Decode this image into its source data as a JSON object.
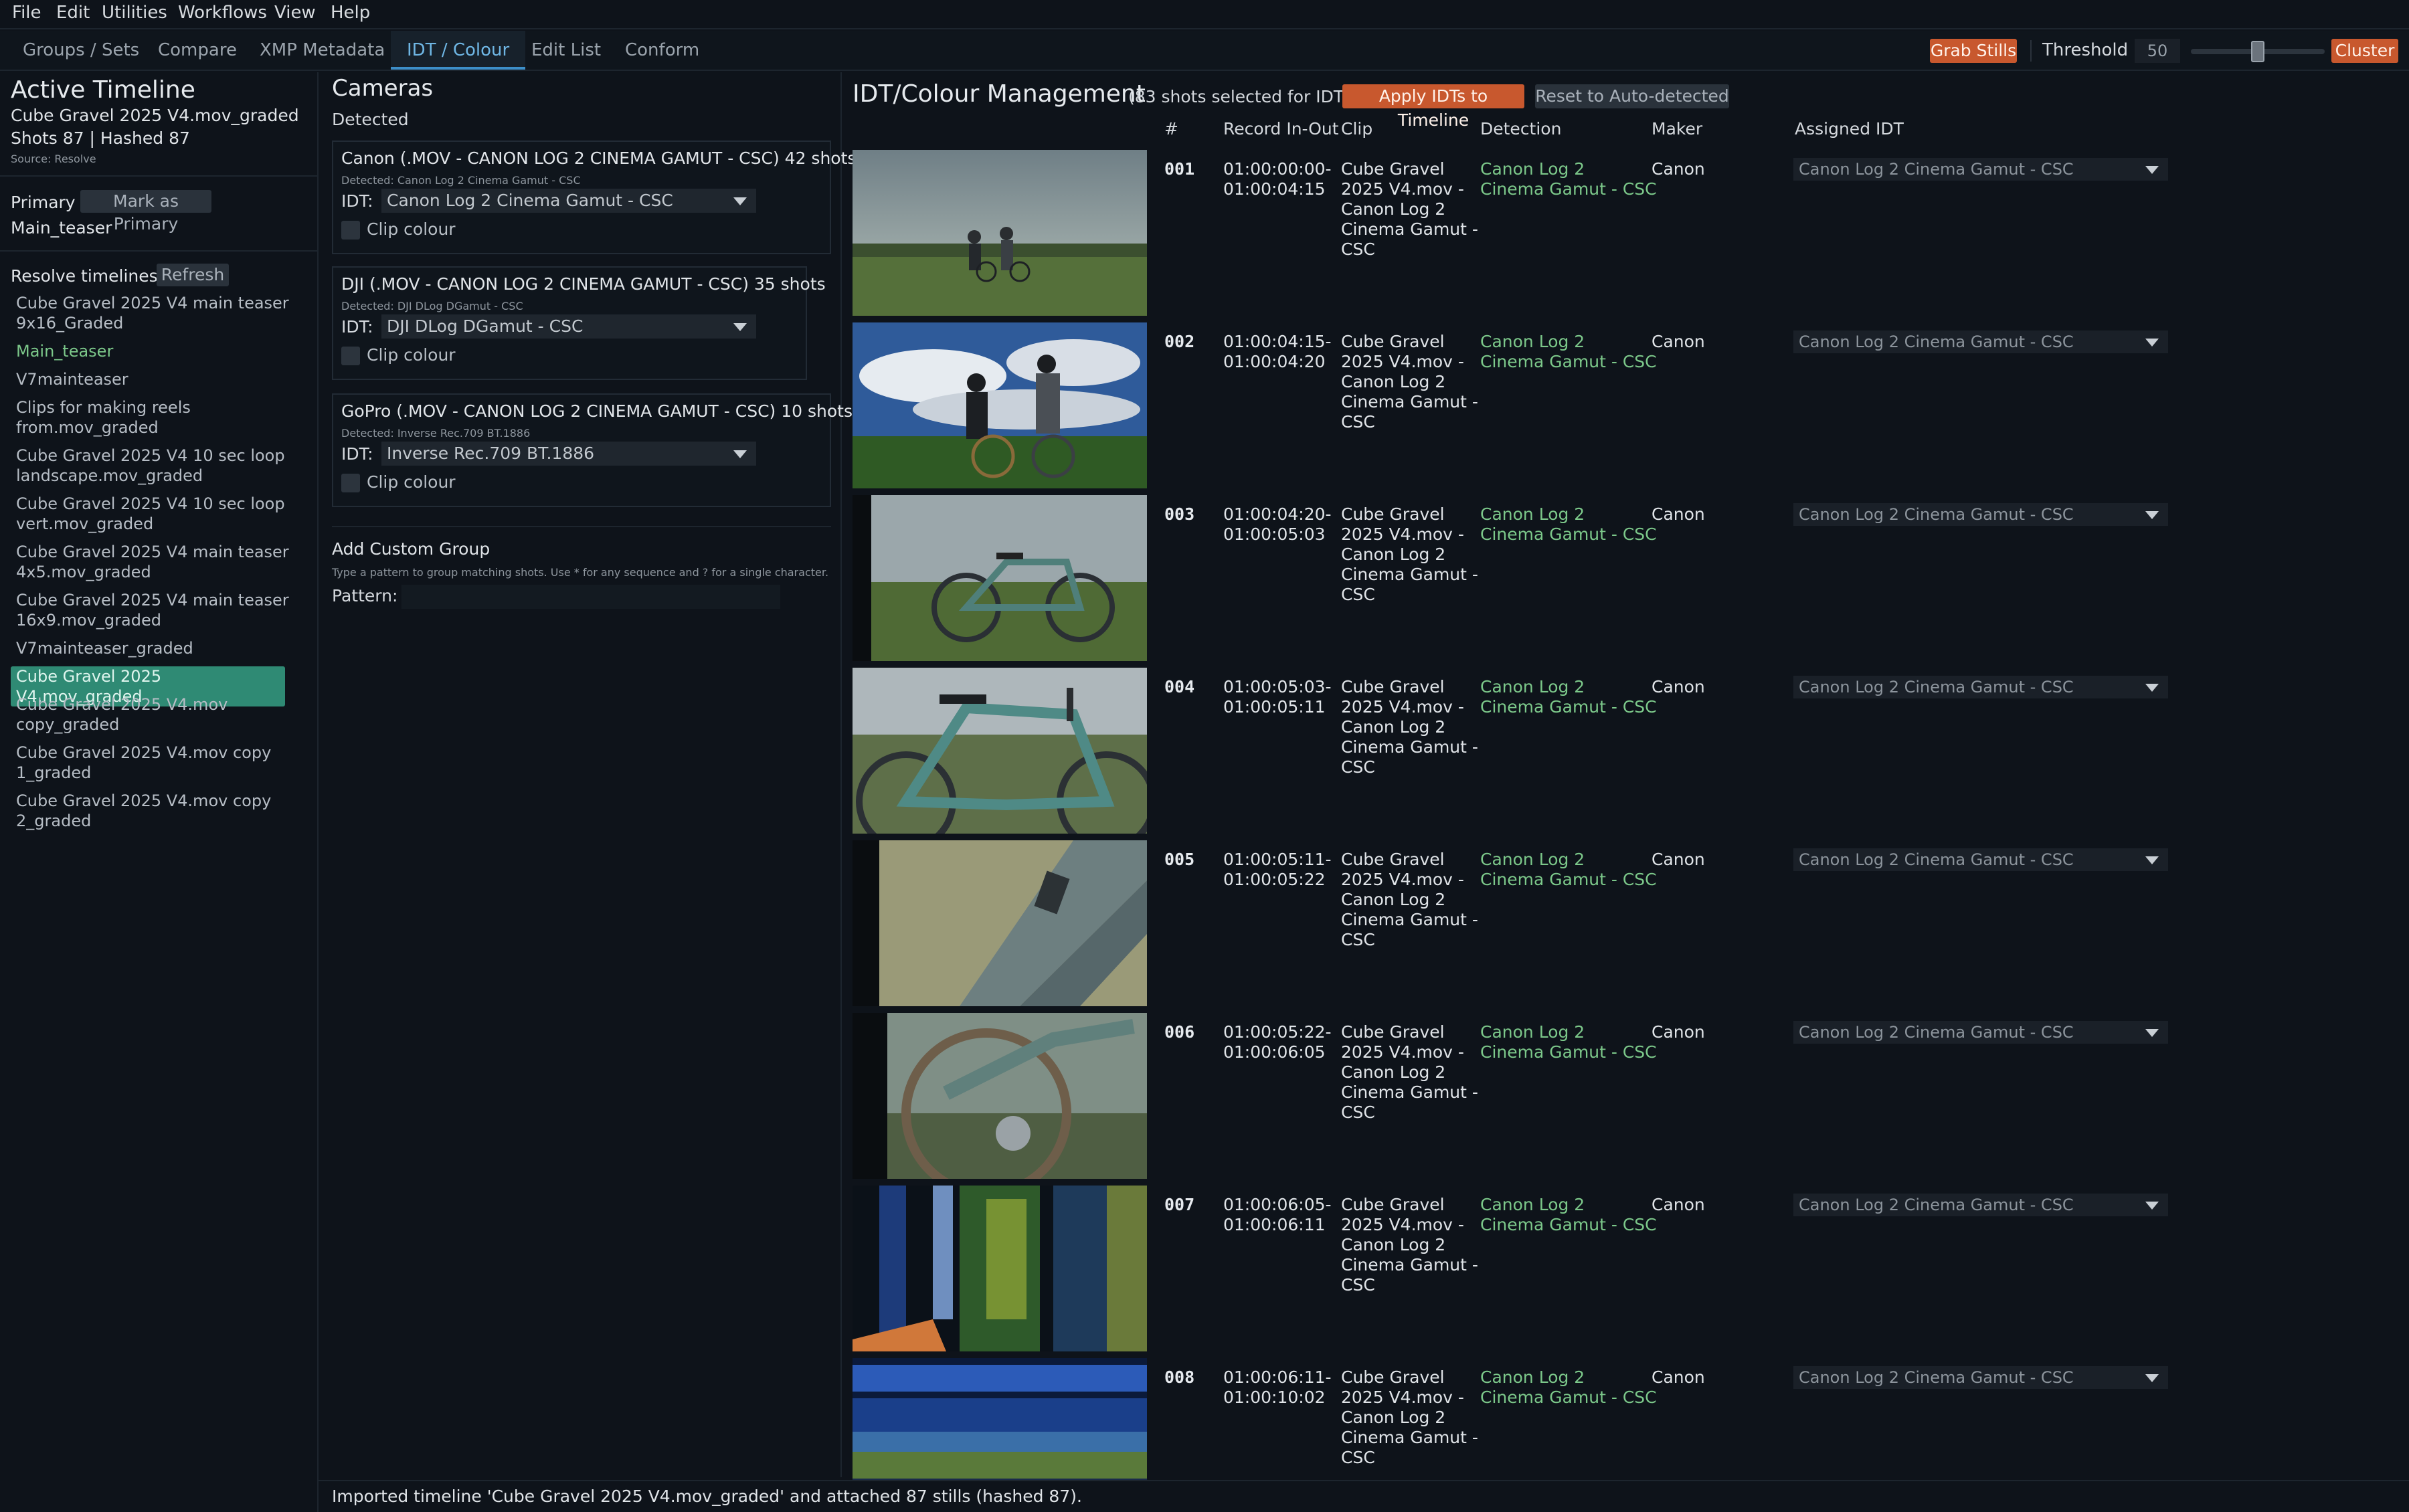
{
  "menu": [
    "File",
    "Edit",
    "Utilities",
    "Workflows",
    "View",
    "Help"
  ],
  "tabs": [
    {
      "label": "Groups / Sets"
    },
    {
      "label": "Compare"
    },
    {
      "label": "XMP Metadata"
    },
    {
      "label": "IDT / Colour",
      "active": true
    },
    {
      "label": "Edit List"
    },
    {
      "label": "Conform"
    }
  ],
  "toolbar": {
    "grab_stills": "Grab Stills",
    "threshold_label": "Threshold",
    "threshold_value": "50",
    "threshold_fraction": 0.5,
    "cluster": "Cluster"
  },
  "left": {
    "active_title": "Active Timeline",
    "timeline_name": "Cube Gravel 2025 V4.mov_graded",
    "shots_info": "Shots 87 | Hashed 87",
    "source": "Source: Resolve",
    "primary_label": "Primary",
    "mark_primary": "Mark as Primary",
    "primary_value": "Main_teaser",
    "resolve_label": "Resolve timelines",
    "refresh": "Refresh",
    "timelines": [
      {
        "text": "Cube Gravel 2025 V4 main teaser\n9x16_Graded"
      },
      {
        "text": "Main_teaser",
        "green": true
      },
      {
        "text": "V7mainteaser"
      },
      {
        "text": "Clips for making reels\nfrom.mov_graded"
      },
      {
        "text": "Cube Gravel 2025 V4 10 sec loop\nlandscape.mov_graded"
      },
      {
        "text": "Cube Gravel 2025 V4 10 sec loop\nvert.mov_graded"
      },
      {
        "text": "Cube Gravel 2025 V4 main teaser\n4x5.mov_graded"
      },
      {
        "text": "Cube Gravel 2025 V4 main teaser\n16x9.mov_graded"
      },
      {
        "text": "V7mainteaser_graded"
      },
      {
        "text": "Cube Gravel 2025 V4.mov_graded",
        "selected": true
      },
      {
        "text": "Cube Gravel 2025 V4.mov\ncopy_graded"
      },
      {
        "text": "Cube Gravel 2025 V4.mov copy\n1_graded"
      },
      {
        "text": "Cube Gravel 2025 V4.mov copy\n2_graded"
      }
    ]
  },
  "cameras": {
    "title": "Cameras",
    "detected_label": "Detected",
    "idt_label": "IDT:",
    "clip_colour": "Clip colour",
    "groups": [
      {
        "title": "Canon (.MOV - CANON LOG 2 CINEMA GAMUT - CSC)   42 shots",
        "detected": "Detected: Canon Log 2 Cinema Gamut - CSC",
        "idt": "Canon Log 2 Cinema Gamut - CSC"
      },
      {
        "title": "DJI (.MOV - CANON LOG 2 CINEMA GAMUT - CSC)   35 shots",
        "detected": "Detected: DJI DLog DGamut - CSC",
        "idt": "DJI DLog DGamut - CSC"
      },
      {
        "title": "GoPro (.MOV - CANON LOG 2 CINEMA GAMUT - CSC)   10 shots",
        "detected": "Detected: Inverse Rec.709 BT.1886",
        "idt": "Inverse Rec.709 BT.1886"
      }
    ],
    "custom_title": "Add Custom Group",
    "custom_hint": "Type a pattern to group matching shots. Use * for any sequence and ? for a single character.",
    "pattern_label": "Pattern:",
    "pattern_value": ""
  },
  "idt": {
    "title": "IDT/Colour Management",
    "selected_info": "(83 shots selected for IDT)",
    "apply": "Apply IDTs to Timeline",
    "reset": "Reset to Auto-detected",
    "headers": {
      "num": "#",
      "record": "Record In-Out",
      "clip": "Clip",
      "detection": "Detection",
      "maker": "Maker",
      "assigned": "Assigned IDT"
    },
    "rows": [
      {
        "num": "001",
        "rec_in": "01:00:00:00-",
        "rec_out": "01:00:04:15",
        "clip": "Cube Gravel\n2025 V4.mov -\nCanon Log 2\nCinema Gamut -\nCSC",
        "detection": "Canon Log 2\nCinema Gamut - CSC",
        "maker": "Canon",
        "assigned": "Canon Log 2 Cinema Gamut - CSC"
      },
      {
        "num": "002",
        "rec_in": "01:00:04:15-",
        "rec_out": "01:00:04:20",
        "clip": "Cube Gravel\n2025 V4.mov -\nCanon Log 2\nCinema Gamut -\nCSC",
        "detection": "Canon Log 2\nCinema Gamut - CSC",
        "maker": "Canon",
        "assigned": "Canon Log 2 Cinema Gamut - CSC"
      },
      {
        "num": "003",
        "rec_in": "01:00:04:20-",
        "rec_out": "01:00:05:03",
        "clip": "Cube Gravel\n2025 V4.mov -\nCanon Log 2\nCinema Gamut -\nCSC",
        "detection": "Canon Log 2\nCinema Gamut - CSC",
        "maker": "Canon",
        "assigned": "Canon Log 2 Cinema Gamut - CSC"
      },
      {
        "num": "004",
        "rec_in": "01:00:05:03-",
        "rec_out": "01:00:05:11",
        "clip": "Cube Gravel\n2025 V4.mov -\nCanon Log 2\nCinema Gamut -\nCSC",
        "detection": "Canon Log 2\nCinema Gamut - CSC",
        "maker": "Canon",
        "assigned": "Canon Log 2 Cinema Gamut - CSC"
      },
      {
        "num": "005",
        "rec_in": "01:00:05:11-",
        "rec_out": "01:00:05:22",
        "clip": "Cube Gravel\n2025 V4.mov -\nCanon Log 2\nCinema Gamut -\nCSC",
        "detection": "Canon Log 2\nCinema Gamut - CSC",
        "maker": "Canon",
        "assigned": "Canon Log 2 Cinema Gamut - CSC"
      },
      {
        "num": "006",
        "rec_in": "01:00:05:22-",
        "rec_out": "01:00:06:05",
        "clip": "Cube Gravel\n2025 V4.mov -\nCanon Log 2\nCinema Gamut -\nCSC",
        "detection": "Canon Log 2\nCinema Gamut - CSC",
        "maker": "Canon",
        "assigned": "Canon Log 2 Cinema Gamut - CSC"
      },
      {
        "num": "007",
        "rec_in": "01:00:06:05-",
        "rec_out": "01:00:06:11",
        "clip": "Cube Gravel\n2025 V4.mov -\nCanon Log 2\nCinema Gamut -\nCSC",
        "detection": "Canon Log 2\nCinema Gamut - CSC",
        "maker": "Canon",
        "assigned": "Canon Log 2 Cinema Gamut - CSC"
      },
      {
        "num": "008",
        "rec_in": "01:00:06:11-",
        "rec_out": "01:00:10:02",
        "clip": "Cube Gravel\n2025 V4.mov -\nCanon Log 2\nCinema Gamut -\nCSC",
        "detection": "Canon Log 2\nCinema Gamut - CSC",
        "maker": "Canon",
        "assigned": "Canon Log 2 Cinema Gamut - CSC"
      }
    ]
  },
  "status": "Imported timeline 'Cube Gravel 2025 V4.mov_graded' and attached 87 stills (hashed 87).",
  "colors": {
    "accent_orange": "#c8582e",
    "accent_blue": "#6fb6e4",
    "green": "#7cc88a",
    "selected_bg": "#2f8a74"
  }
}
